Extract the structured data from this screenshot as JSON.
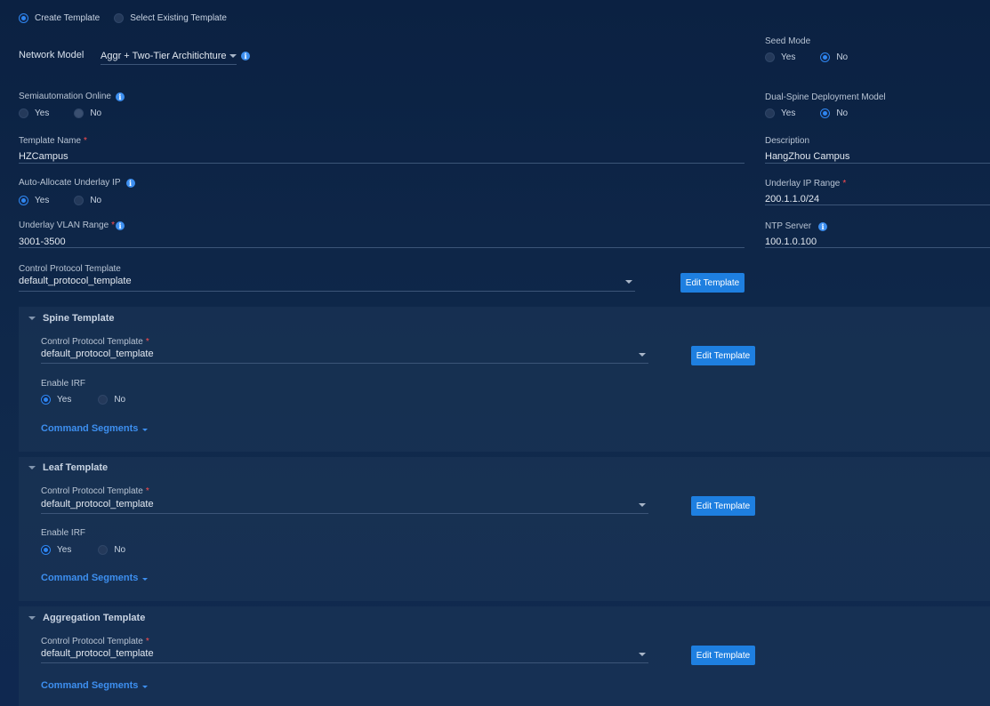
{
  "mode": {
    "create": "Create Template",
    "select_existing": "Select Existing Template"
  },
  "network_model": {
    "label": "Network Model",
    "value": "Aggr + Two-Tier Architichture"
  },
  "seed_mode": {
    "label": "Seed Mode",
    "yes": "Yes",
    "no": "No",
    "selected": "No"
  },
  "semiautomation": {
    "label": "Semiautomation Online",
    "yes": "Yes",
    "no": "No",
    "selected": "No"
  },
  "dual_spine": {
    "label": "Dual-Spine Deployment Model",
    "yes": "Yes",
    "no": "No",
    "selected": "No"
  },
  "template_name": {
    "label": "Template Name",
    "required": "*",
    "value": "HZCampus"
  },
  "description": {
    "label": "Description",
    "value": "HangZhou Campus"
  },
  "auto_allocate": {
    "label": "Auto-Allocate Underlay IP",
    "yes": "Yes",
    "no": "No",
    "selected": "Yes"
  },
  "underlay_ip_range": {
    "label": "Underlay IP Range",
    "required": "*",
    "value": "200.1.1.0/24"
  },
  "underlay_vlan_range": {
    "label": "Underlay VLAN Range",
    "required": "*",
    "value": "3001-3500"
  },
  "ntp_server": {
    "label": "NTP Server",
    "value": "100.1.0.100"
  },
  "control_protocol": {
    "label": "Control Protocol Template",
    "value": "default_protocol_template",
    "edit_label": "Edit Template"
  },
  "spine": {
    "title": "Spine Template",
    "cp_label": "Control Protocol Template",
    "required": "*",
    "cp_value": "default_protocol_template",
    "edit_label": "Edit Template",
    "irf_label": "Enable IRF",
    "yes": "Yes",
    "no": "No",
    "irf_selected": "Yes",
    "command_segments": "Command Segments"
  },
  "leaf": {
    "title": "Leaf Template",
    "cp_label": "Control Protocol Template",
    "required": "*",
    "cp_value": "default_protocol_template",
    "edit_label": "Edit Template",
    "irf_label": "Enable IRF",
    "yes": "Yes",
    "no": "No",
    "irf_selected": "Yes",
    "command_segments": "Command Segments"
  },
  "aggregation": {
    "title": "Aggregation Template",
    "cp_label": "Control Protocol Template",
    "required": "*",
    "cp_value": "default_protocol_template",
    "edit_label": "Edit Template",
    "command_segments": "Command Segments"
  },
  "colors": {
    "accent": "#1e7fe0",
    "link": "#3d8ff0",
    "required": "#ff4d4f"
  },
  "icons": {
    "info": "info-icon",
    "dropdown": "chevron-down-icon",
    "collapse": "collapse-caret-icon"
  }
}
